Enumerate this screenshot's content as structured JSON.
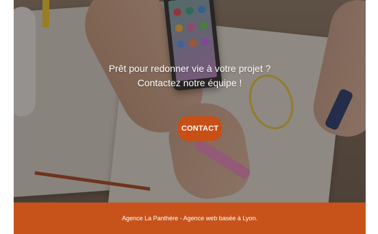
{
  "hero": {
    "headline_line1": "Prêt pour redonner vie à votre projet ?",
    "headline_line2": "Contactez notre équipe !",
    "cta_label": "CONTACT",
    "background_icon": "desk-workspace-photo"
  },
  "footer": {
    "text": "Agence La Panthère - Agence web basée à Lyon."
  },
  "colors": {
    "accent": "#c8531a",
    "button": "#c84f15",
    "text_on_dark": "#ffffff"
  }
}
